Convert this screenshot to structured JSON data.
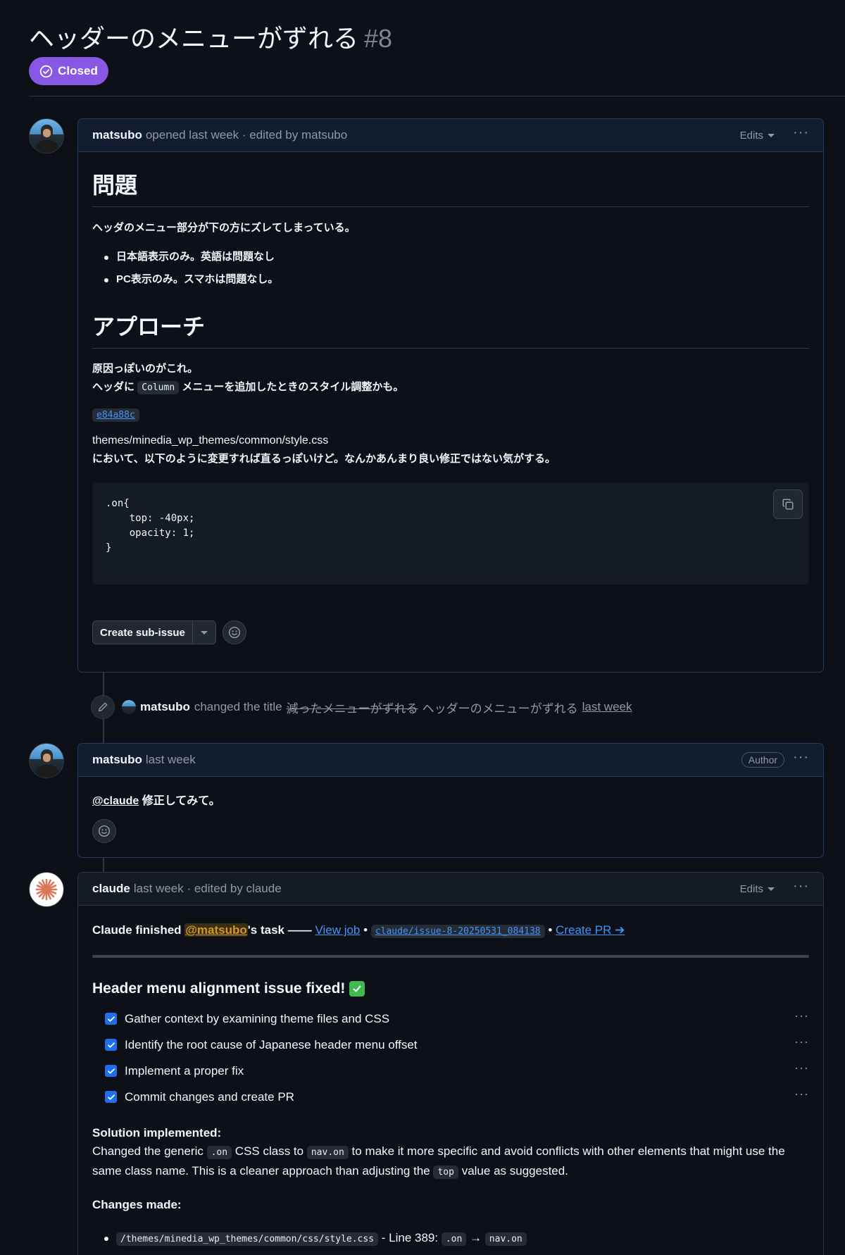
{
  "issue": {
    "title": "ヘッダーのメニューがずれる",
    "number": "#8",
    "state": "Closed",
    "state_color": "#8957e5"
  },
  "comment1": {
    "author": "matsubo",
    "meta": "opened last week · edited by matsubo",
    "edits_label": "Edits",
    "heading1": "問題",
    "para1": "ヘッダのメニュー部分が下の方にズレてしまっている。",
    "bullets": [
      "日本語表示のみ。英語は問題なし",
      "PC表示のみ。スマホは問題なし。"
    ],
    "heading2": "アプローチ",
    "para2_line1": "原因っぽいのがこれ。",
    "para2_line2_pre": "ヘッダに",
    "para2_code": "Column",
    "para2_line2_post": "メニューを追加したときのスタイル調整かも。",
    "commit": "e84a88c",
    "file_path": "themes/minedia_wp_themes/common/style.css",
    "para3": "において、以下のように変更すれば直るっぽいけど。なんかあんまり良い修正ではない気がする。",
    "code_block": ".on{\n    top: -40px;\n    opacity: 1;\n}",
    "sub_issue_label": "Create sub-issue"
  },
  "title_event": {
    "author": "matsubo",
    "action": "changed the title",
    "old_title": "減ったメニューがずれる",
    "new_title": "ヘッダーのメニューがずれる",
    "time": "last week"
  },
  "comment2": {
    "author": "matsubo",
    "meta": "last week",
    "badge": "Author",
    "mention": "@claude",
    "text": "修正してみて。"
  },
  "comment3": {
    "author": "claude",
    "meta": "last week · edited by claude",
    "edits_label": "Edits",
    "status_pre": "Claude finished",
    "status_mention": "@matsubo",
    "status_post": "'s task ——",
    "view_job": "View job",
    "sep": "•",
    "branch": "claude/issue-8-20250531_084138",
    "create_pr": "Create PR ➔",
    "heading": "Header menu alignment issue fixed!",
    "tasks": [
      "Gather context by examining theme files and CSS",
      "Identify the root cause of Japanese header menu offset",
      "Implement a proper fix",
      "Commit changes and create PR"
    ],
    "solution_title": "Solution implemented:",
    "solution_pre": "Changed the generic",
    "solution_code1": ".on",
    "solution_mid1": "CSS class to",
    "solution_code2": "nav.on",
    "solution_mid2": "to make it more specific and avoid conflicts with other elements that might use the same class name. This is a cleaner approach than adjusting the",
    "solution_code3": "top",
    "solution_post": "value as suggested.",
    "changes_title": "Changes made:",
    "change_path": "/themes/minedia_wp_themes/common/css/style.css",
    "change_mid": "- Line 389:",
    "change_code1": ".on",
    "change_arrow": "→",
    "change_code2": "nav.on"
  }
}
